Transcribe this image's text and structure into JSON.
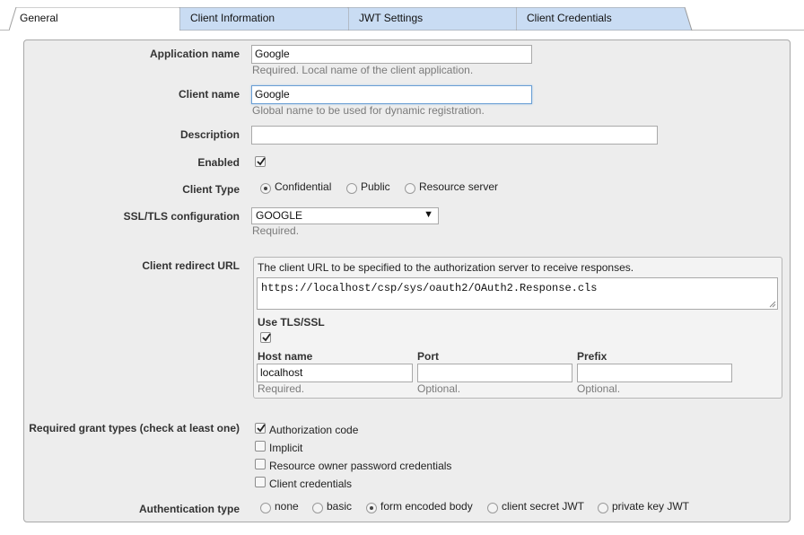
{
  "tabs": [
    {
      "label": "General",
      "active": true
    },
    {
      "label": "Client Information",
      "active": false
    },
    {
      "label": "JWT Settings",
      "active": false
    },
    {
      "label": "Client Credentials",
      "active": false
    }
  ],
  "form": {
    "app_name": {
      "label": "Application name",
      "value": "Google",
      "hint": "Required. Local name of the client application."
    },
    "client_name": {
      "label": "Client name",
      "value": "Google",
      "hint": "Global name to be used for dynamic registration."
    },
    "description": {
      "label": "Description",
      "value": ""
    },
    "enabled": {
      "label": "Enabled",
      "checked": true
    },
    "client_type": {
      "label": "Client Type",
      "options": [
        "Confidential",
        "Public",
        "Resource server"
      ],
      "selected": "Confidential"
    },
    "ssl": {
      "label": "SSL/TLS configuration",
      "value": "GOOGLE",
      "hint": "Required."
    },
    "redirect": {
      "label": "Client redirect URL",
      "description": "The client URL to be specified to the authorization server to receive responses.",
      "url": "https://localhost/csp/sys/oauth2/OAuth2.Response.cls",
      "use_tls_label": "Use TLS/SSL",
      "use_tls": true,
      "host": {
        "label": "Host name",
        "value": "localhost",
        "hint": "Required."
      },
      "port": {
        "label": "Port",
        "value": "",
        "hint": "Optional."
      },
      "prefix": {
        "label": "Prefix",
        "value": "",
        "hint": "Optional."
      }
    },
    "grants": {
      "label": "Required grant types (check at least one)",
      "options": [
        {
          "label": "Authorization code",
          "checked": true
        },
        {
          "label": "Implicit",
          "checked": false
        },
        {
          "label": "Resource owner password credentials",
          "checked": false
        },
        {
          "label": "Client credentials",
          "checked": false
        }
      ]
    },
    "auth_type": {
      "label": "Authentication type",
      "options": [
        "none",
        "basic",
        "form encoded body",
        "client secret JWT",
        "private key JWT"
      ],
      "selected": "form encoded body"
    }
  },
  "colors": {
    "tab_active": "#ffffff",
    "tab_inactive": "#c9dcf3",
    "panel_bg": "#ededed",
    "focus_border": "#6a9fd4"
  }
}
